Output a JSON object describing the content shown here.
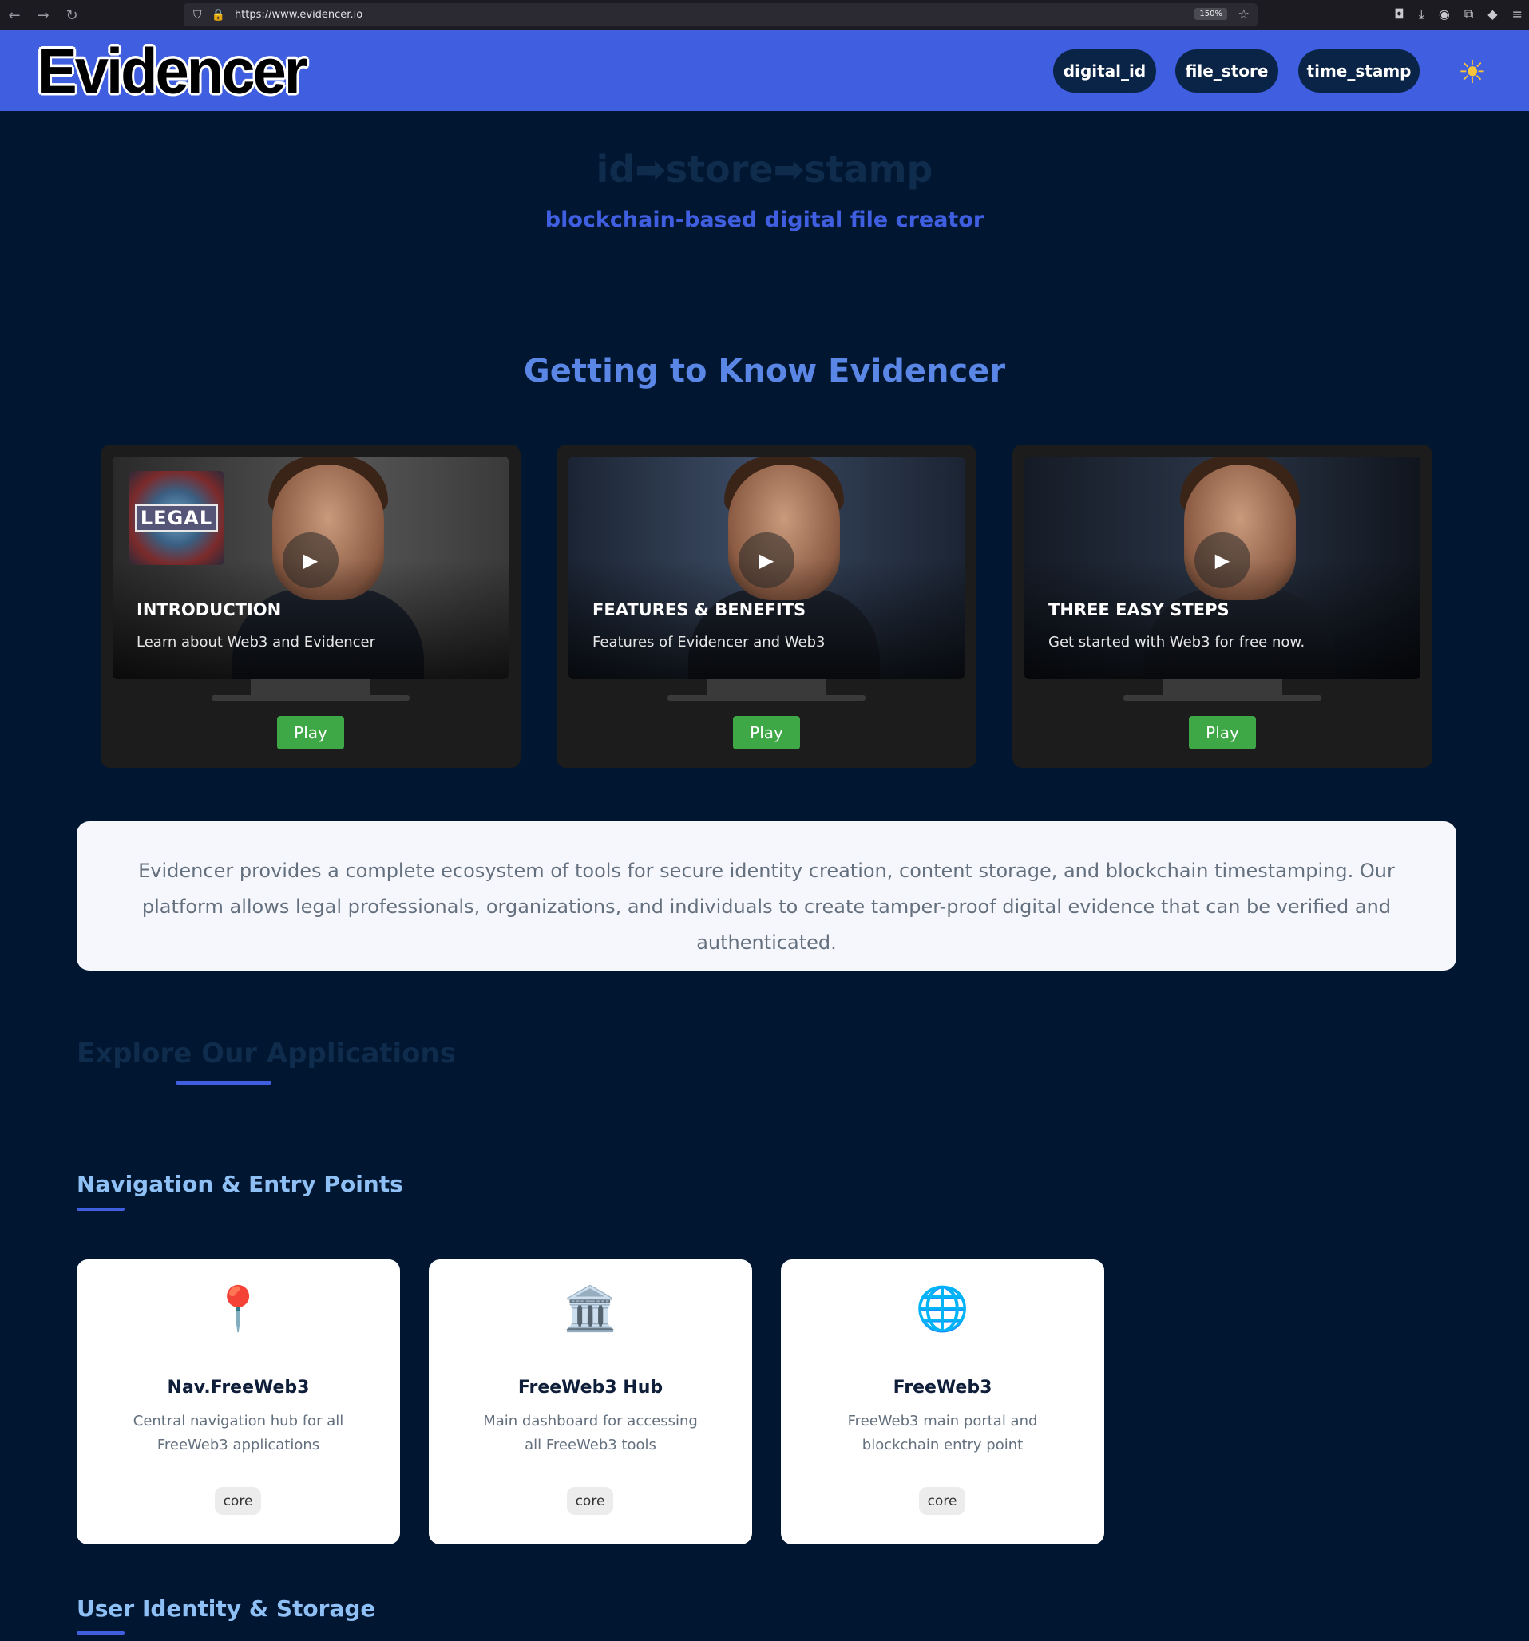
{
  "browser": {
    "url": "https://www.evidencer.io",
    "zoom": "150%"
  },
  "header": {
    "logo": "Evidencer",
    "nav": [
      "digital_id",
      "file_store",
      "time_stamp"
    ]
  },
  "hero": {
    "title": "id➡store➡stamp",
    "subtitle": "blockchain-based digital file creator"
  },
  "intro_section": {
    "title": "Getting to Know Evidencer",
    "videos": [
      {
        "label": "INTRODUCTION",
        "desc": "Learn about Web3 and Evidencer",
        "button": "Play",
        "badge": "LEGAL"
      },
      {
        "label": "FEATURES & BENEFITS",
        "desc": "Features of Evidencer and Web3",
        "button": "Play"
      },
      {
        "label": "THREE EASY STEPS",
        "desc": "Get started with Web3 for free now.",
        "button": "Play"
      }
    ]
  },
  "description": "Evidencer provides a complete ecosystem of tools for secure identity creation, content storage, and blockchain timestamping. Our platform allows legal professionals, organizations, and individuals to create tamper-proof digital evidence that can be verified and authenticated.",
  "explore": {
    "title": "Explore Our Applications",
    "groups": [
      {
        "title": "Navigation & Entry Points",
        "apps": [
          {
            "icon": "pin-icon",
            "glyph": "📍",
            "name": "Nav.FreeWeb3",
            "desc": "Central navigation hub for all FreeWeb3 applications",
            "tag": "core"
          },
          {
            "icon": "bank-icon",
            "glyph": "🏛️",
            "name": "FreeWeb3 Hub",
            "desc": "Main dashboard for accessing all FreeWeb3 tools",
            "tag": "core"
          },
          {
            "icon": "globe-icon",
            "glyph": "🌐",
            "name": "FreeWeb3",
            "desc": "FreeWeb3 main portal and blockchain entry point",
            "tag": "core"
          }
        ]
      },
      {
        "title": "User Identity & Storage"
      }
    ]
  },
  "colors": {
    "background": "#001631",
    "header": "#3f5ee0",
    "nav_pill": "#0a2447",
    "play_button": "#3fa846",
    "section_title": "#5a86e6"
  }
}
